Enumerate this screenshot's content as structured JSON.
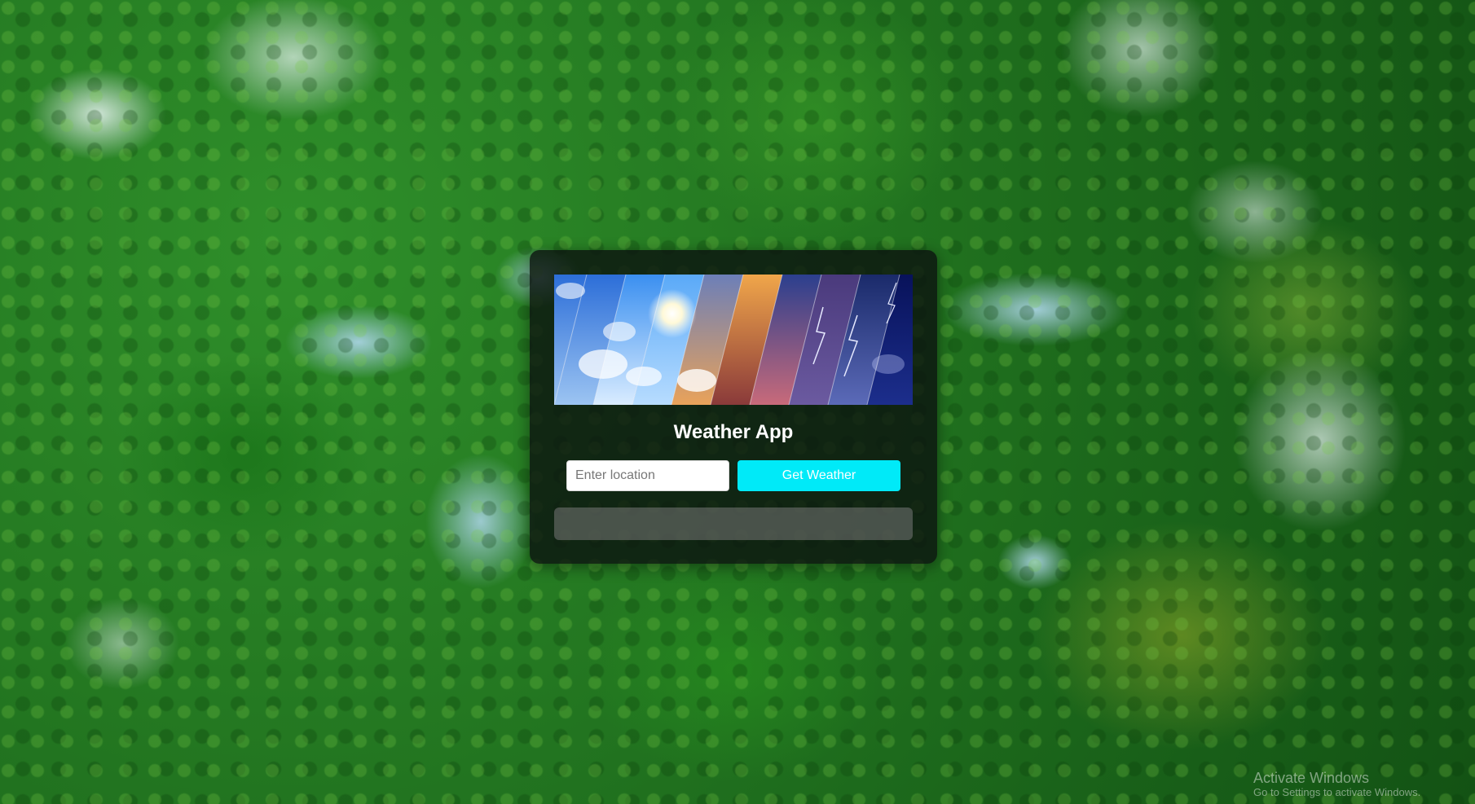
{
  "app": {
    "title": "Weather App"
  },
  "banner": {
    "icon": "weather-collage-image"
  },
  "form": {
    "location_placeholder": "Enter location",
    "location_value": "",
    "submit_label": "Get Weather"
  },
  "result": {
    "text": ""
  },
  "system_watermark": {
    "line1": "Activate Windows",
    "line2": "Go to Settings to activate Windows."
  },
  "colors": {
    "button": "#00eaf8",
    "card": "#0c1410"
  }
}
